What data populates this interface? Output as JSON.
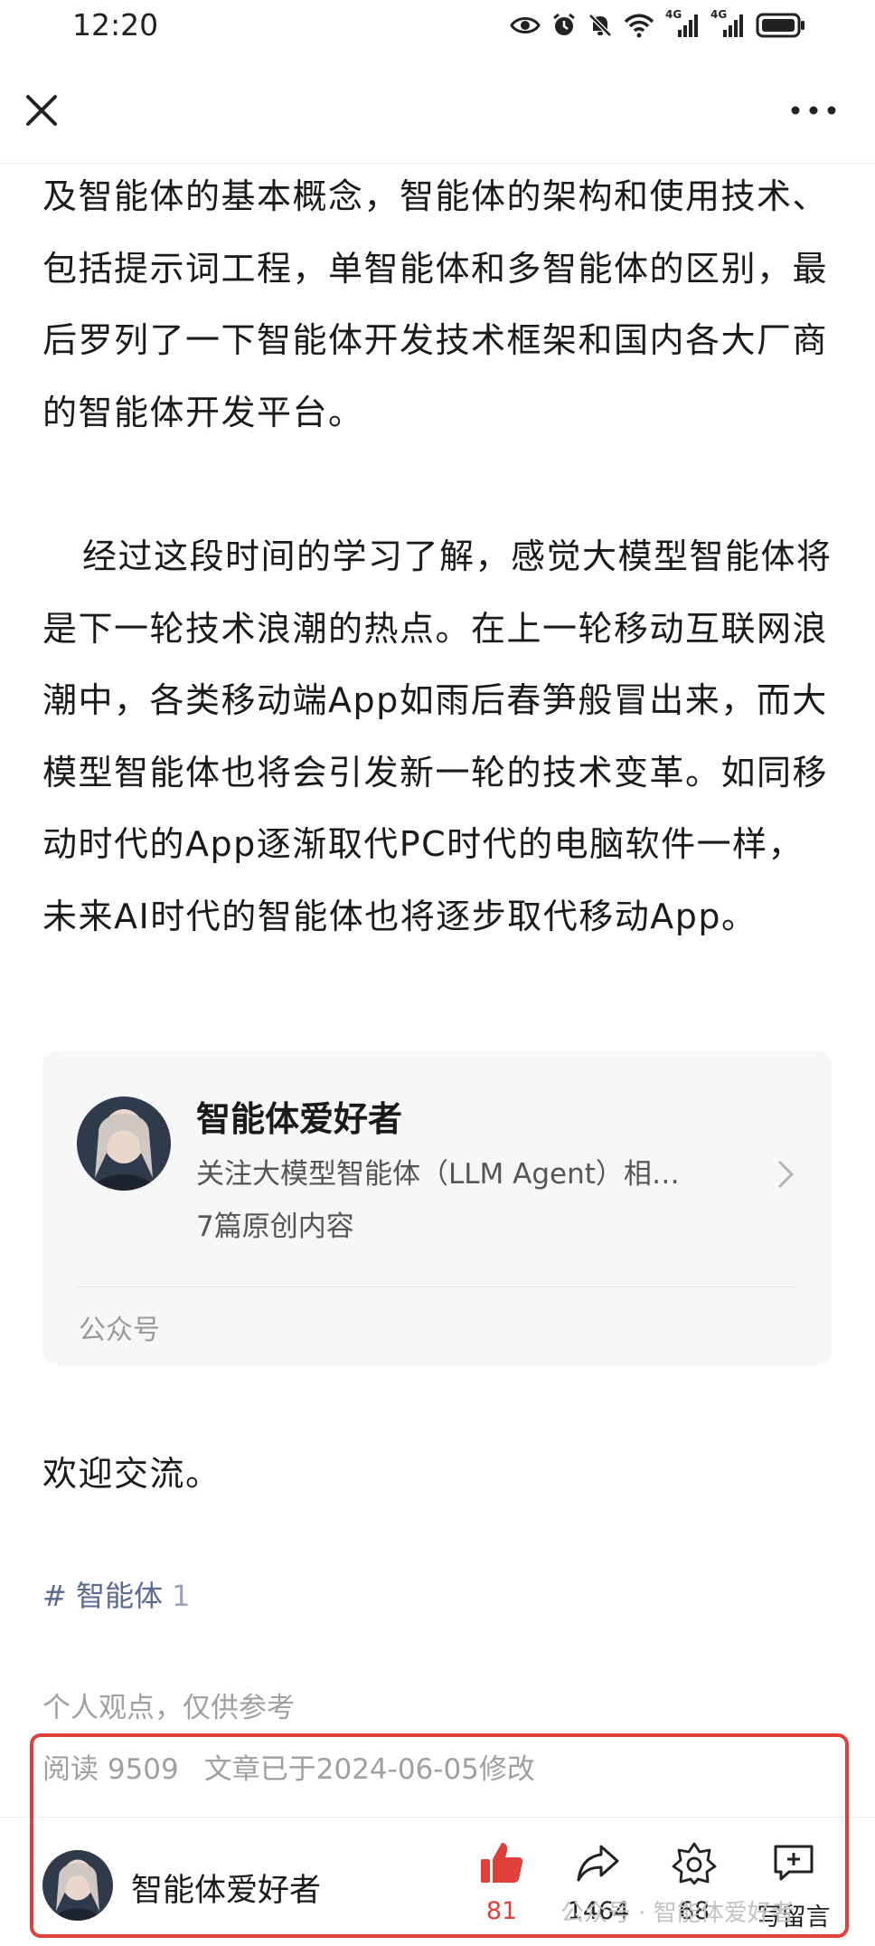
{
  "status_bar": {
    "time": "12:20",
    "net_label_1": "4G",
    "net_label_2": "4G",
    "icons": [
      "eye-icon",
      "alarm-icon",
      "bell-mute-icon",
      "wifi-icon",
      "signal-icon",
      "signal-icon",
      "battery-icon"
    ]
  },
  "nav": {
    "close_icon": "close-icon",
    "more_icon": "more-icon"
  },
  "article": {
    "paragraph_1": "及智能体的基本概念，智能体的架构和使用技术、包括提示词工程，单智能体和多智能体的区别，最后罗列了一下智能体开发技术框架和国内各大厂商的智能体开发平台。",
    "paragraph_2": "经过这段时间的学习了解，感觉大模型智能体将是下一轮技术浪潮的热点。在上一轮移动互联网浪潮中，各类移动端App如雨后春笋般冒出来，而大模型智能体也将会引发新一轮的技术变革。如同移动时代的App逐渐取代PC时代的电脑软件一样，未来AI时代的智能体也将逐步取代移动App。"
  },
  "account_card": {
    "name": "智能体爱好者",
    "description": "关注大模型智能体（LLM Agent）相…",
    "original_count": "7篇原创内容",
    "type_label": "公众号"
  },
  "welcome_text": "欢迎交流。",
  "tag": {
    "label": "# 智能体",
    "count": "1"
  },
  "disclaimer": "个人观点，仅供参考",
  "meta": {
    "reads": "阅读 9509",
    "modified": "文章已于2024-06-05修改"
  },
  "bottom_bar": {
    "author": "智能体爱好者",
    "like_count": "81",
    "share_count": "1464",
    "favorite_count": "68",
    "comment_label": "写留言",
    "accent_color": "#e0403a"
  },
  "watermark": "公众号 · 智能体爱好者"
}
